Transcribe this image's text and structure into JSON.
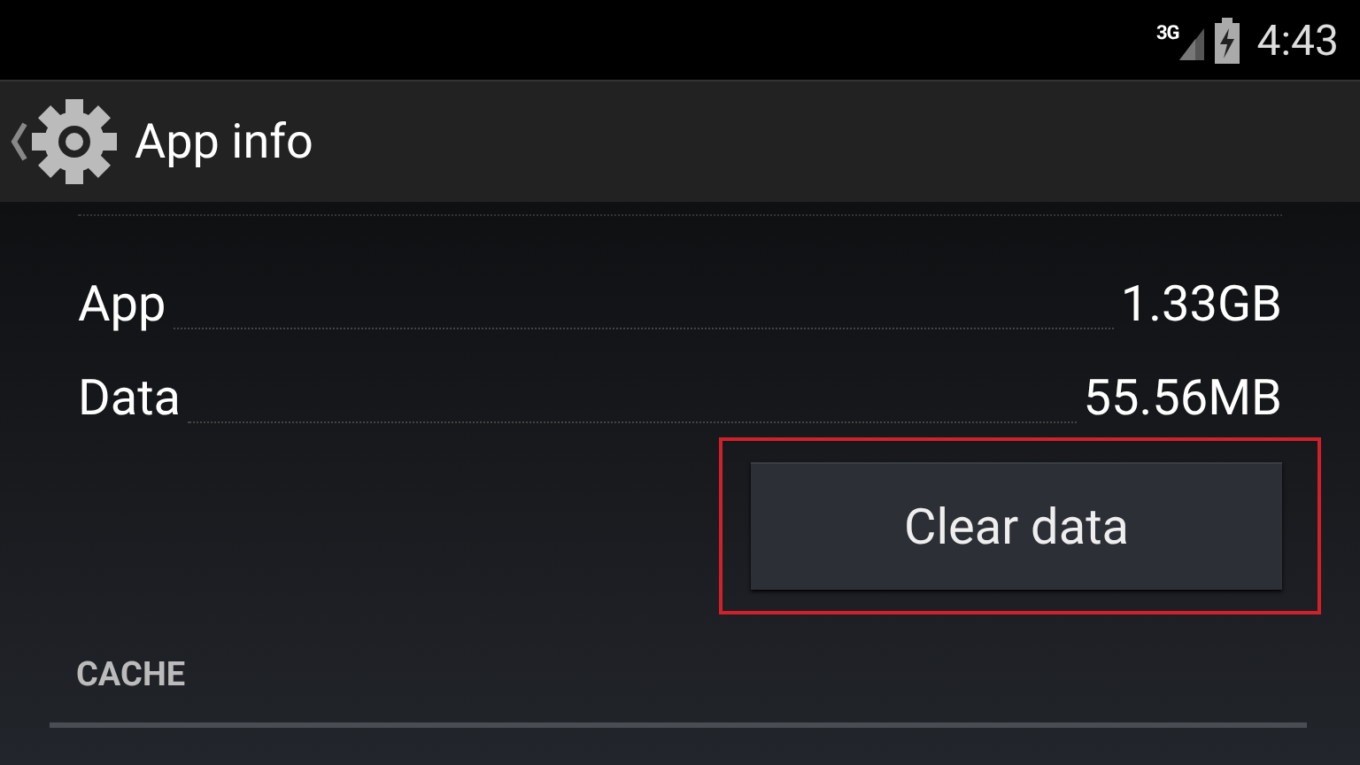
{
  "status_bar": {
    "network": "3G",
    "time": "4:43"
  },
  "action_bar": {
    "title": "App info"
  },
  "storage_rows": [
    {
      "label": "App",
      "value": "1.33GB"
    },
    {
      "label": "Data",
      "value": "55.56MB"
    }
  ],
  "clear_button": {
    "label": "Clear data",
    "highlighted": true
  },
  "section_header": "CACHE"
}
